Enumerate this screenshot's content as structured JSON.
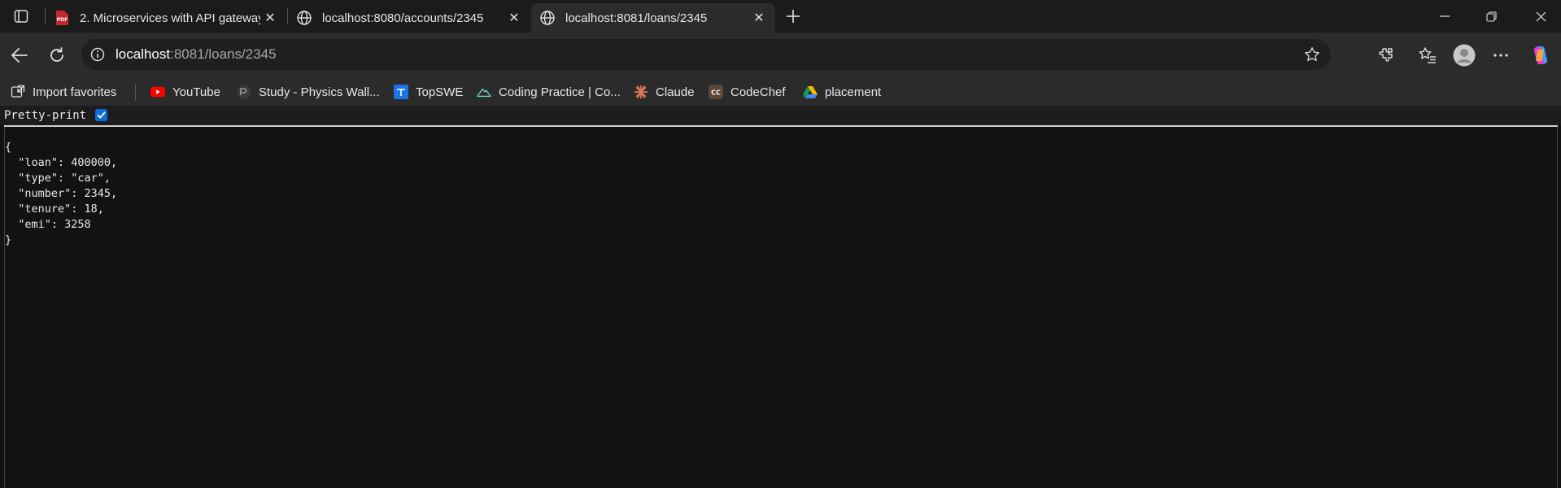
{
  "browser": {
    "tabs": [
      {
        "title": "2. Microservices with API gateway",
        "icon": "pdf-icon",
        "active": false
      },
      {
        "title": "localhost:8080/accounts/2345",
        "icon": "globe-icon",
        "active": false
      },
      {
        "title": "localhost:8081/loans/2345",
        "icon": "globe-icon",
        "active": true
      }
    ],
    "address": {
      "host": "localhost",
      "rest": ":8081/loans/2345"
    },
    "favorites": [
      {
        "label": "Import favorites",
        "icon": "import-favorites-icon"
      },
      {
        "label": "YouTube",
        "icon": "youtube-icon"
      },
      {
        "label": "Study - Physics Wall...",
        "icon": "physics-wallah-icon"
      },
      {
        "label": "TopSWE",
        "icon": "topswe-icon"
      },
      {
        "label": "Coding Practice | Co...",
        "icon": "mountain-icon"
      },
      {
        "label": "Claude",
        "icon": "claude-icon"
      },
      {
        "label": "CodeChef",
        "icon": "codechef-icon"
      },
      {
        "label": "placement",
        "icon": "google-drive-icon"
      }
    ],
    "colors": {
      "tabstrip": "#1b1b1b",
      "toolbar": "#2b2b2b",
      "content": "#121212",
      "accent": "#0f6cd6"
    }
  },
  "viewer": {
    "pretty_print_label": "Pretty-print",
    "pretty_print_checked": true,
    "json_lines": [
      "{",
      "  \"loan\": 400000,",
      "  \"type\": \"car\",",
      "  \"number\": 2345,",
      "  \"tenure\": 18,",
      "  \"emi\": 3258",
      "}"
    ]
  }
}
